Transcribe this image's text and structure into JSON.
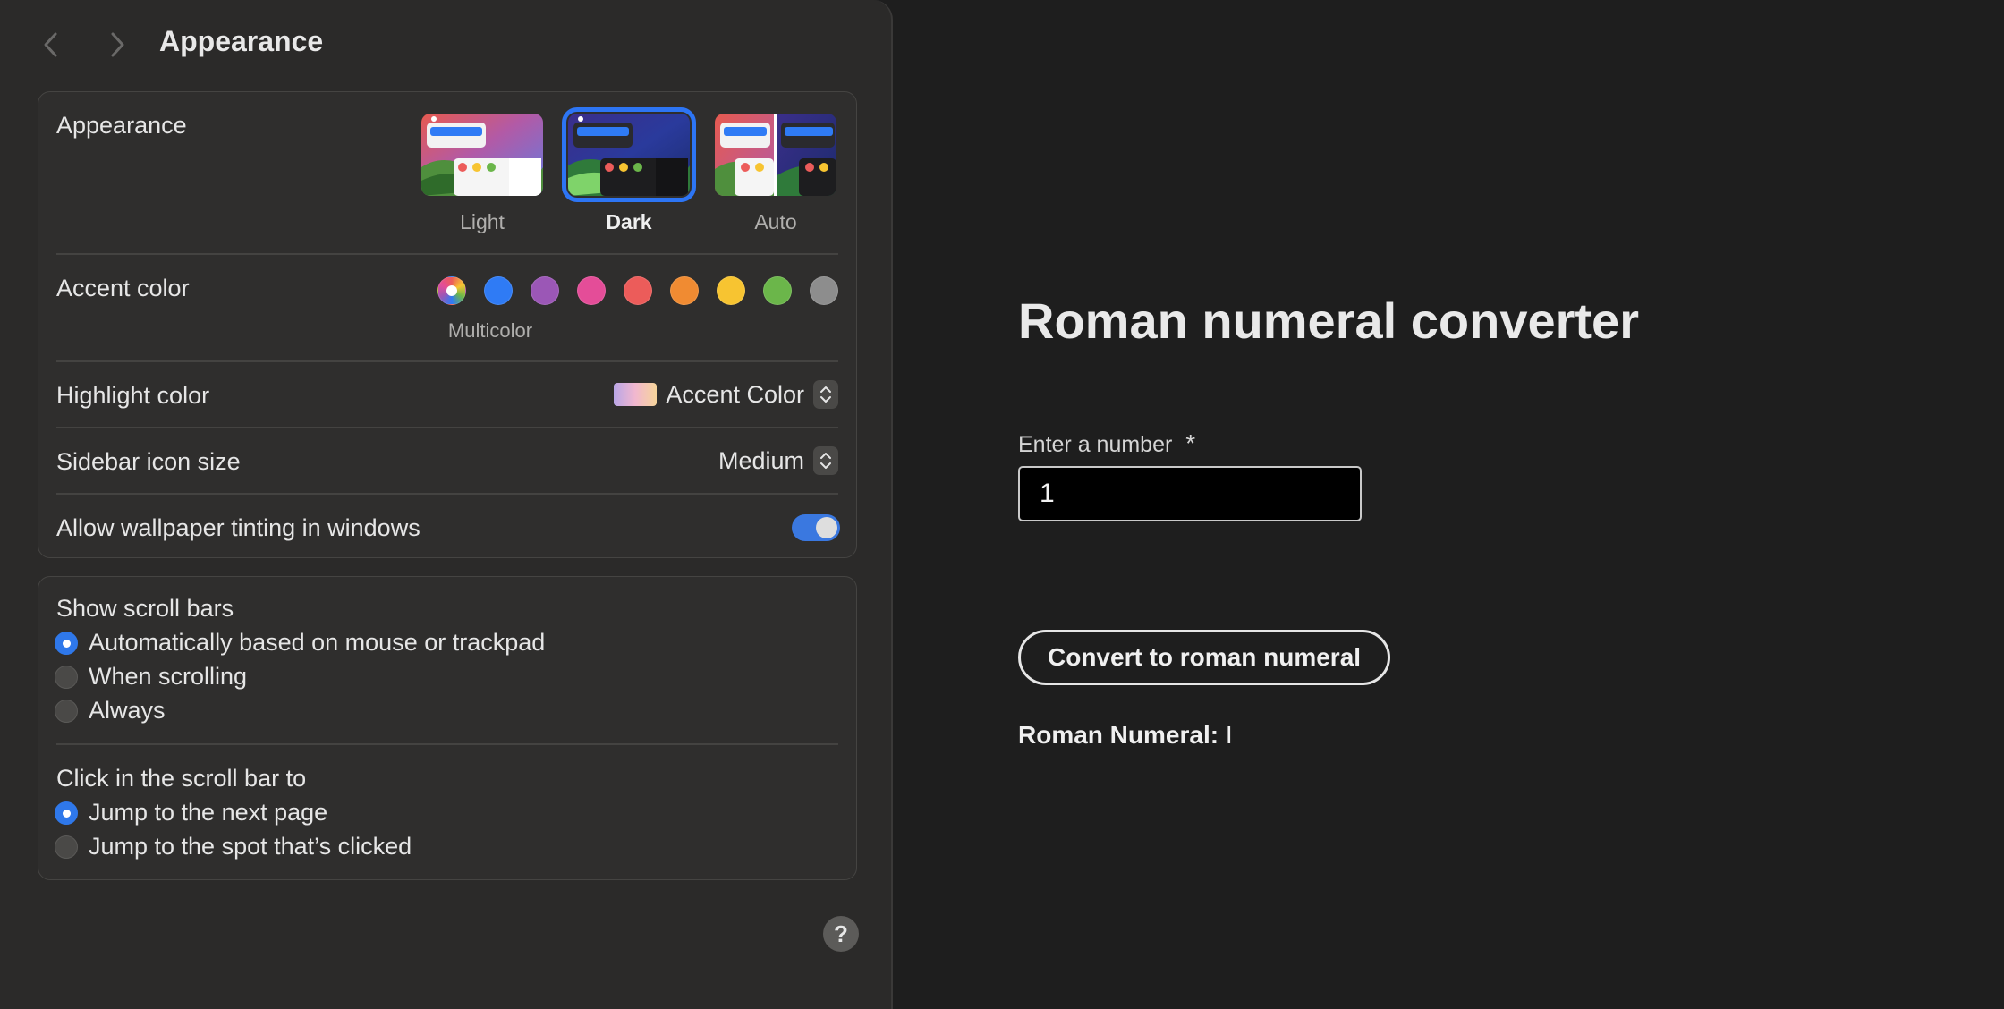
{
  "settings": {
    "title": "Appearance",
    "appearance": {
      "label": "Appearance",
      "options": [
        "Light",
        "Dark",
        "Auto"
      ],
      "selected": "Dark"
    },
    "accent": {
      "label": "Accent color",
      "caption": "Multicolor",
      "colors": [
        "multicolor",
        "#2f7bf5",
        "#9b57b6",
        "#e44d98",
        "#ec5c5a",
        "#f08b32",
        "#f7c431",
        "#6bb64a",
        "#8d8d8d"
      ],
      "selected": "multicolor"
    },
    "highlight": {
      "label": "Highlight color",
      "value": "Accent Color"
    },
    "sidebar_icon_size": {
      "label": "Sidebar icon size",
      "value": "Medium"
    },
    "wallpaper_tinting": {
      "label": "Allow wallpaper tinting in windows",
      "on": true
    },
    "scroll_bars": {
      "label": "Show scroll bars",
      "options": [
        "Automatically based on mouse or trackpad",
        "When scrolling",
        "Always"
      ],
      "selected": "Automatically based on mouse or trackpad"
    },
    "click_scroll": {
      "label": "Click in the scroll bar to",
      "options": [
        "Jump to the next page",
        "Jump to the spot that’s clicked"
      ],
      "selected": "Jump to the next page"
    },
    "help": "?"
  },
  "converter": {
    "title": "Roman numeral converter",
    "field_label": "Enter a number",
    "required_mark": "*",
    "input_value": "1",
    "button_label": "Convert to roman numeral",
    "result_label": "Roman Numeral:",
    "result_value": "I"
  }
}
